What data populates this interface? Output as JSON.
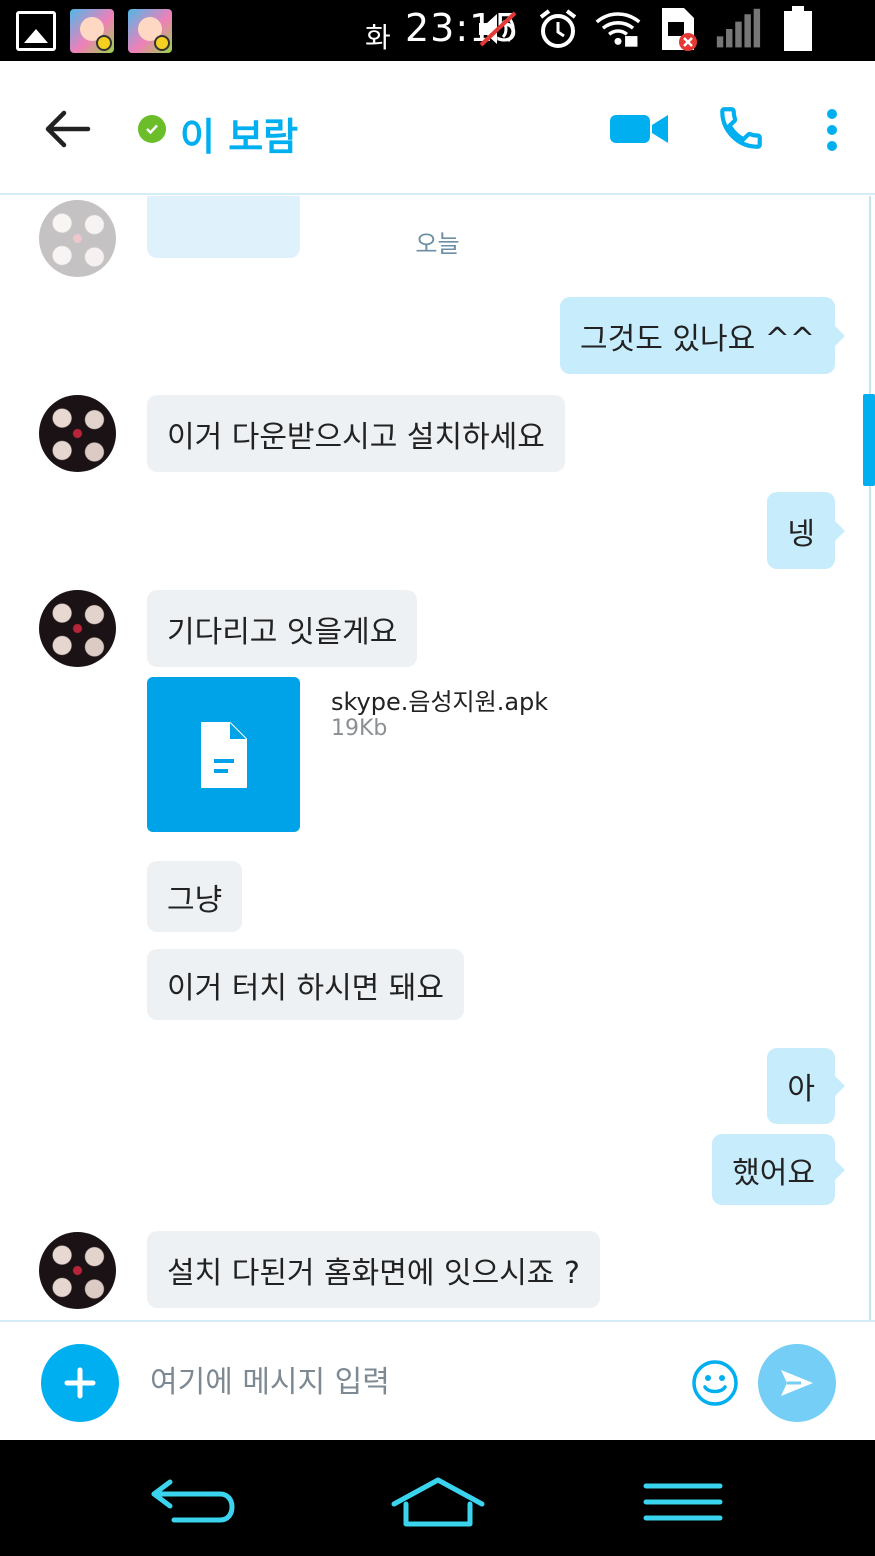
{
  "status_bar": {
    "day": "화",
    "time": "23:15",
    "icons": [
      "gallery-icon",
      "app-icon",
      "app-icon",
      "mute-icon",
      "alarm-icon",
      "wifi-icon",
      "sim-error-icon",
      "signal-icon",
      "battery-icon"
    ]
  },
  "header": {
    "contact_name": "이 보람",
    "presence": "online",
    "accent_color": "#00aff0"
  },
  "chat": {
    "date_separator": "오늘",
    "messages": [
      {
        "side": "out",
        "text": "그것도 있나요 ^^"
      },
      {
        "side": "in",
        "text": "이거 다운받으시고 설치하세요"
      },
      {
        "side": "out",
        "text": "넹"
      },
      {
        "side": "in",
        "text": "기다리고 잇을게요"
      },
      {
        "side": "in",
        "type": "file",
        "file_name": "skype.음성지원.apk",
        "file_size": "19Kb"
      },
      {
        "side": "in",
        "text": "그냥"
      },
      {
        "side": "in",
        "text": "이거 터치 하시면 돼요"
      },
      {
        "side": "out",
        "text": "아"
      },
      {
        "side": "out",
        "text": "했어요"
      },
      {
        "side": "in",
        "text": "설치 다된거 홈화면에 잇으시죠 ?"
      }
    ]
  },
  "composer": {
    "placeholder": "여기에 메시지 입력"
  }
}
